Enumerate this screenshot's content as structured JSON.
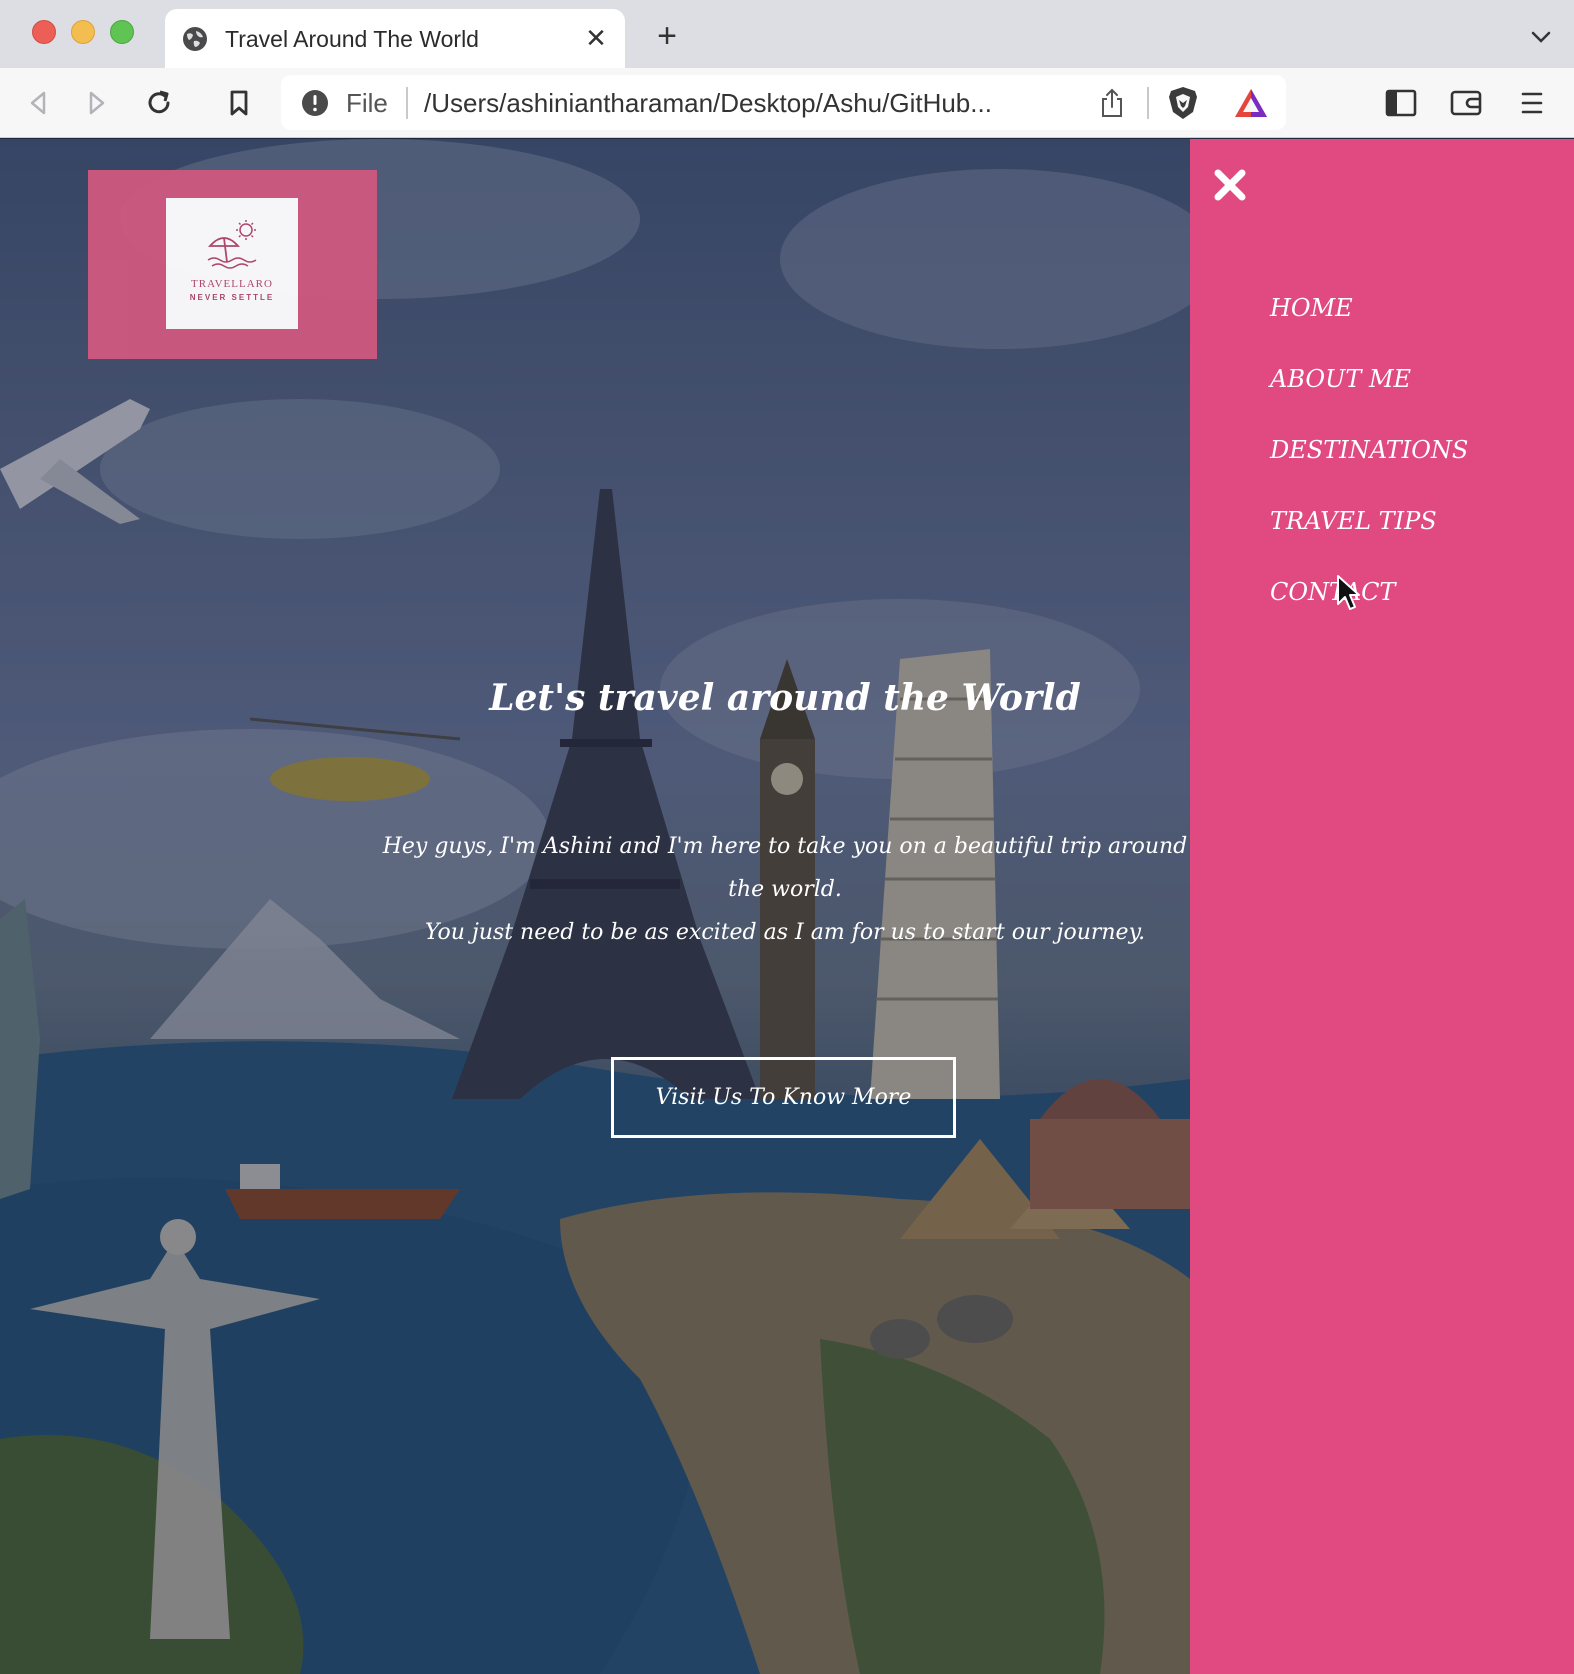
{
  "browser": {
    "tab_title": "Travel Around The World",
    "omnibox_scheme": "File",
    "omnibox_url": "/Users/ashiniantharaman/Desktop/Ashu/GitHub..."
  },
  "logo": {
    "name": "TRAVELLARO",
    "tagline": "NEVER SETTLE"
  },
  "hero": {
    "title": "Let's travel around the World",
    "line1": "Hey guys, I'm Ashini and I'm here to take you on a beautiful trip around the world.",
    "line2": "You just need to be as excited as I am for us to start our journey.",
    "button_label": "Visit Us To Know More"
  },
  "nav": {
    "items": [
      {
        "label": "HOME"
      },
      {
        "label": "ABOUT ME"
      },
      {
        "label": "DESTINATIONS"
      },
      {
        "label": "TRAVEL TIPS"
      },
      {
        "label": "CONTACT"
      }
    ]
  },
  "colors": {
    "sidenav_bg": "#e04a80",
    "logo_bg": "#d0587f",
    "logo_text": "#b2476b"
  }
}
